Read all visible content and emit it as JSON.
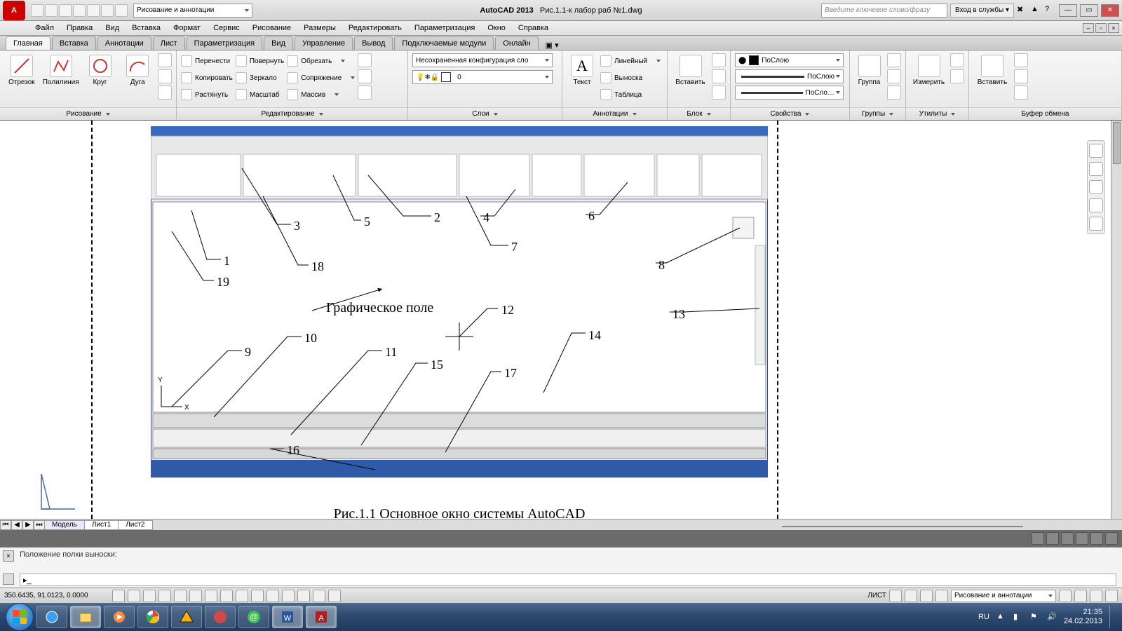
{
  "title": {
    "app": "AutoCAD 2013",
    "file": "Рис.1.1-к лабор раб №1.dwg"
  },
  "workspace_selector": "Рисование и аннотации",
  "search_placeholder": "Введите ключевое слово/фразу",
  "signin": "Вход в службы",
  "menubar": [
    "Файл",
    "Правка",
    "Вид",
    "Вставка",
    "Формат",
    "Сервис",
    "Рисование",
    "Размеры",
    "Редактировать",
    "Параметризация",
    "Окно",
    "Справка"
  ],
  "ribtabs": [
    "Главная",
    "Вставка",
    "Аннотации",
    "Лист",
    "Параметризация",
    "Вид",
    "Управление",
    "Вывод",
    "Подключаемые модули",
    "Онлайн"
  ],
  "panels": {
    "draw": {
      "title": "Рисование",
      "line": "Отрезок",
      "pline": "Полилиния",
      "circle": "Круг",
      "arc": "Дуга"
    },
    "modify": {
      "title": "Редактирование",
      "move": "Перенести",
      "rotate": "Повернуть",
      "trim": "Обрезать",
      "copy": "Копировать",
      "mirror": "Зеркало",
      "fillet": "Сопряжение",
      "stretch": "Растянуть",
      "scale": "Масштаб",
      "array": "Массив"
    },
    "layers": {
      "title": "Слои",
      "unsaved": "Несохраненная конфигурация сло",
      "current": "0"
    },
    "annot": {
      "title": "Аннотации",
      "text": "Текст",
      "linear": "Линейный",
      "leader": "Выноска",
      "table": "Таблица"
    },
    "block": {
      "title": "Блок",
      "insert": "Вставить"
    },
    "props": {
      "title": "Свойства",
      "bylayer": "ПоСлою",
      "bylayer2": "ПоСлою",
      "bylayer3": "ПоСло…"
    },
    "groups": {
      "title": "Группы",
      "group": "Группа"
    },
    "utils": {
      "title": "Утилиты",
      "measure": "Измерить"
    },
    "clip": {
      "title": "Буфер обмена",
      "paste": "Вставить"
    }
  },
  "canvas": {
    "caption": "Рис.1.1 Основное окно системы AutoCAD",
    "centertext": "Графическое поле",
    "labels": {
      "1": "1",
      "2": "2",
      "3": "3",
      "4": "4",
      "5": "5",
      "6": "6",
      "7": "7",
      "8": "8",
      "9": "9",
      "10": "10",
      "11": "11",
      "12": "12",
      "13": "13",
      "14": "14",
      "15": "15",
      "16": "16",
      "17": "17",
      "18": "18",
      "19": "19"
    }
  },
  "tabs": {
    "model": "Модель",
    "l1": "Лист1",
    "l2": "Лист2"
  },
  "cmd": {
    "hist": "Положение полки выноски:"
  },
  "status": {
    "coords": "350.6435, 91.0123, 0.0000",
    "mode": "ЛИСТ",
    "ws": "Рисование и аннотации"
  },
  "tray": {
    "lang": "RU",
    "time": "21:35",
    "date": "24.02.2013"
  }
}
